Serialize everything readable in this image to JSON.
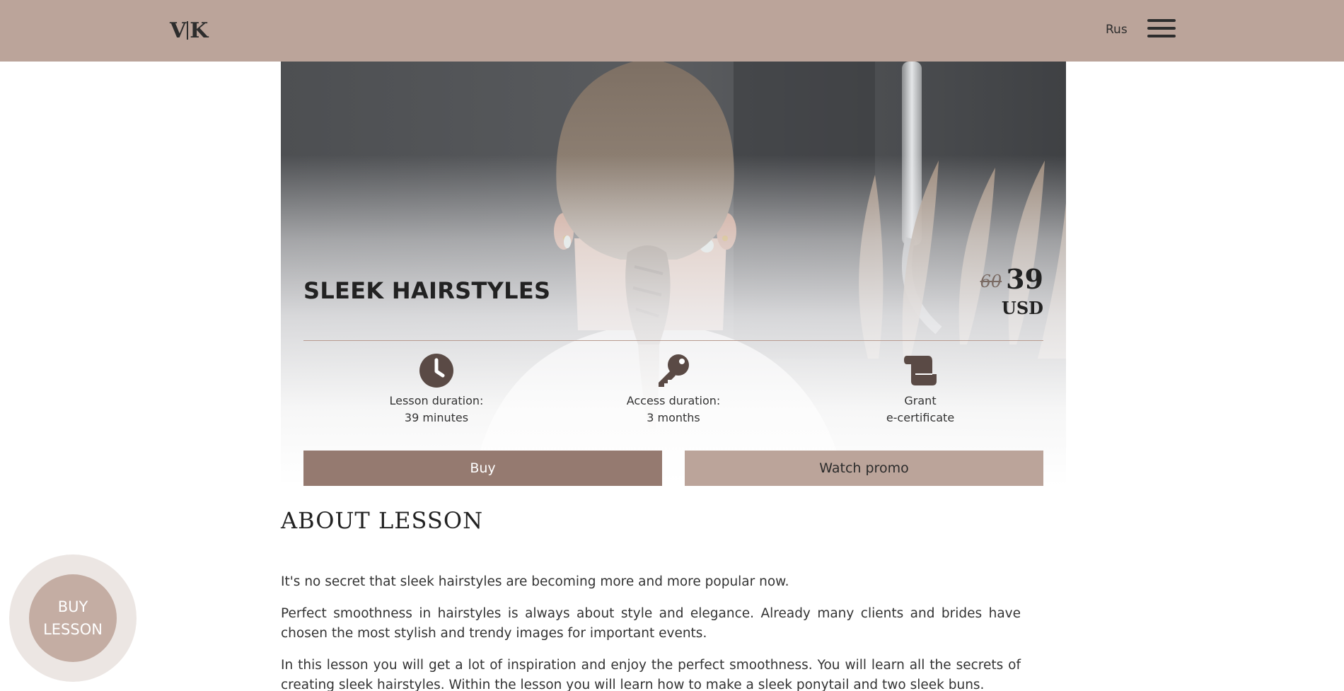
{
  "header": {
    "logo_left": "V",
    "logo_right": "K",
    "language": "Rus",
    "menu_icon": "hamburger-menu-icon"
  },
  "hero": {
    "title": "SLEEK HAIRSTYLES",
    "price_old": "60",
    "price_new": "39",
    "currency": "USD",
    "features": [
      {
        "icon": "clock-icon",
        "label": "Lesson duration:",
        "value": "39 minutes"
      },
      {
        "icon": "key-icon",
        "label": "Access duration:",
        "value": "3 months"
      },
      {
        "icon": "scroll-certificate-icon",
        "label": "Grant",
        "value": "e-certificate"
      }
    ],
    "buy_label": "Buy",
    "promo_label": "Watch promo"
  },
  "about": {
    "title": "ABOUT LESSON",
    "paragraphs": [
      "It's no secret that sleek hairstyles are becoming more and more popular now.",
      "Perfect smoothness in hairstyles is always about style and elegance. Already many clients and brides have chosen the most stylish and trendy images for important events.",
      "In this lesson you will get a lot of inspiration and enjoy the perfect smoothness. You will learn all the secrets of creating sleek hairstyles. Within the lesson you will learn how to make a sleek ponytail and two sleek buns."
    ]
  },
  "floating_button": {
    "line1": "BUY",
    "line2": "LESSON"
  },
  "colors": {
    "header_bg": "#bba49a",
    "buy_button": "#957a70",
    "promo_button": "#bba49a",
    "icon_color": "#5a4a45",
    "float_outer": "#ece6e3",
    "float_inner": "#c4ada3"
  }
}
